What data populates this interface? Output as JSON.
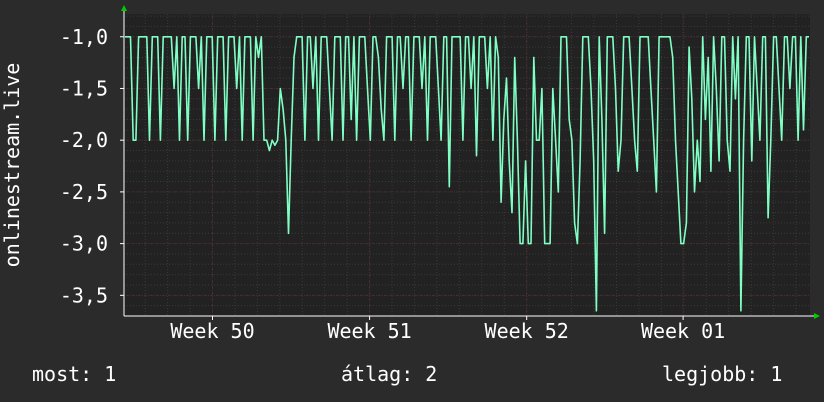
{
  "chart_data": {
    "type": "line",
    "ylabel": "onlinestream.live",
    "ylim": [
      -3.7,
      -0.78
    ],
    "y_ticks": [
      -1.0,
      -1.5,
      -2.0,
      -2.5,
      -3.0,
      -3.5
    ],
    "y_tick_labels": [
      "-1,0",
      "-1,5",
      "-2,0",
      "-2,5",
      "-3,0",
      "-3,5"
    ],
    "x_tick_labels": [
      "Week 50",
      "Week 51",
      "Week 52",
      "Week 01"
    ],
    "grid": true,
    "colors": {
      "background": "#2b2b2b",
      "plot_area": "#222222",
      "major_grid": "#4a2b2b",
      "minor_grid": "#3a3a3a",
      "series": "#7fffc4",
      "axis": "#ffffff",
      "arrow": "#00cc00"
    },
    "series": [
      {
        "values": [
          -1,
          -1,
          -1,
          -2,
          -2,
          -1,
          -1,
          -1,
          -1,
          -2,
          -1,
          -1,
          -1,
          -2,
          -1,
          -1,
          -1,
          -1,
          -1.5,
          -1,
          -2,
          -1,
          -1,
          -2,
          -1,
          -1,
          -1,
          -1.5,
          -1,
          -2,
          -1,
          -1,
          -1,
          -2,
          -1,
          -1,
          -1,
          -2,
          -1,
          -1,
          -1,
          -1.5,
          -1,
          -2,
          -1,
          -1,
          -1,
          -2,
          -1,
          -1.2,
          -1,
          -2,
          -2,
          -2.1,
          -2,
          -2.05,
          -2,
          -1.5,
          -1.7,
          -2,
          -2.9,
          -2,
          -1.2,
          -1,
          -1,
          -1,
          -2,
          -1,
          -1,
          -1.5,
          -1,
          -2,
          -1,
          -1,
          -1,
          -1.5,
          -2,
          -1,
          -1,
          -1,
          -2,
          -1,
          -1,
          -1.8,
          -1,
          -2,
          -1,
          -1,
          -1,
          -1.5,
          -2,
          -1,
          -1,
          -1.2,
          -1.7,
          -2,
          -1,
          -1,
          -1,
          -2,
          -1,
          -1,
          -1.5,
          -1,
          -1,
          -2,
          -1,
          -1,
          -1,
          -1.5,
          -1,
          -2,
          -1,
          -1,
          -1,
          -1.5,
          -2,
          -1,
          -1,
          -2.45,
          -1,
          -1,
          -1,
          -1,
          -2,
          -1,
          -1,
          -1.5,
          -1,
          -2.15,
          -1,
          -1,
          -1,
          -1.5,
          -1,
          -2,
          -1,
          -1.2,
          -2.6,
          -1.8,
          -1.4,
          -2.2,
          -2.7,
          -1.2,
          -2,
          -3,
          -3,
          -2.2,
          -3,
          -3,
          -1.2,
          -2,
          -2,
          -1.5,
          -3,
          -3,
          -3,
          -1.5,
          -2,
          -2.5,
          -1,
          -1,
          -1,
          -1.8,
          -2,
          -2.8,
          -3,
          -2.2,
          -1,
          -1,
          -1,
          -1.5,
          -2.2,
          -3.65,
          -1,
          -1.8,
          -2.9,
          -1,
          -1,
          -1,
          -1.5,
          -2.3,
          -2,
          -1,
          -1,
          -1,
          -1.5,
          -2,
          -2.3,
          -1,
          -1,
          -1,
          -1,
          -1.5,
          -2,
          -2.5,
          -1,
          -1,
          -1,
          -1,
          -1,
          -1.2,
          -2,
          -2.5,
          -3,
          -3,
          -2.8,
          -1.1,
          -1.6,
          -2.5,
          -2,
          -2.4,
          -1,
          -1.8,
          -1.2,
          -2.3,
          -1,
          -1.5,
          -2.2,
          -1,
          -1,
          -2,
          -2.3,
          -1,
          -1.6,
          -1,
          -3.65,
          -2,
          -1,
          -1,
          -2.2,
          -1,
          -1.5,
          -2,
          -1,
          -1,
          -2.75,
          -2,
          -1,
          -1,
          -1.5,
          -2,
          -1,
          -1,
          -1.5,
          -1,
          -1,
          -2,
          -1,
          -1.9,
          -1,
          -1
        ]
      }
    ]
  },
  "stats": {
    "now": "most: 1",
    "average": "átlag: 2",
    "best": "legjobb: 1"
  }
}
